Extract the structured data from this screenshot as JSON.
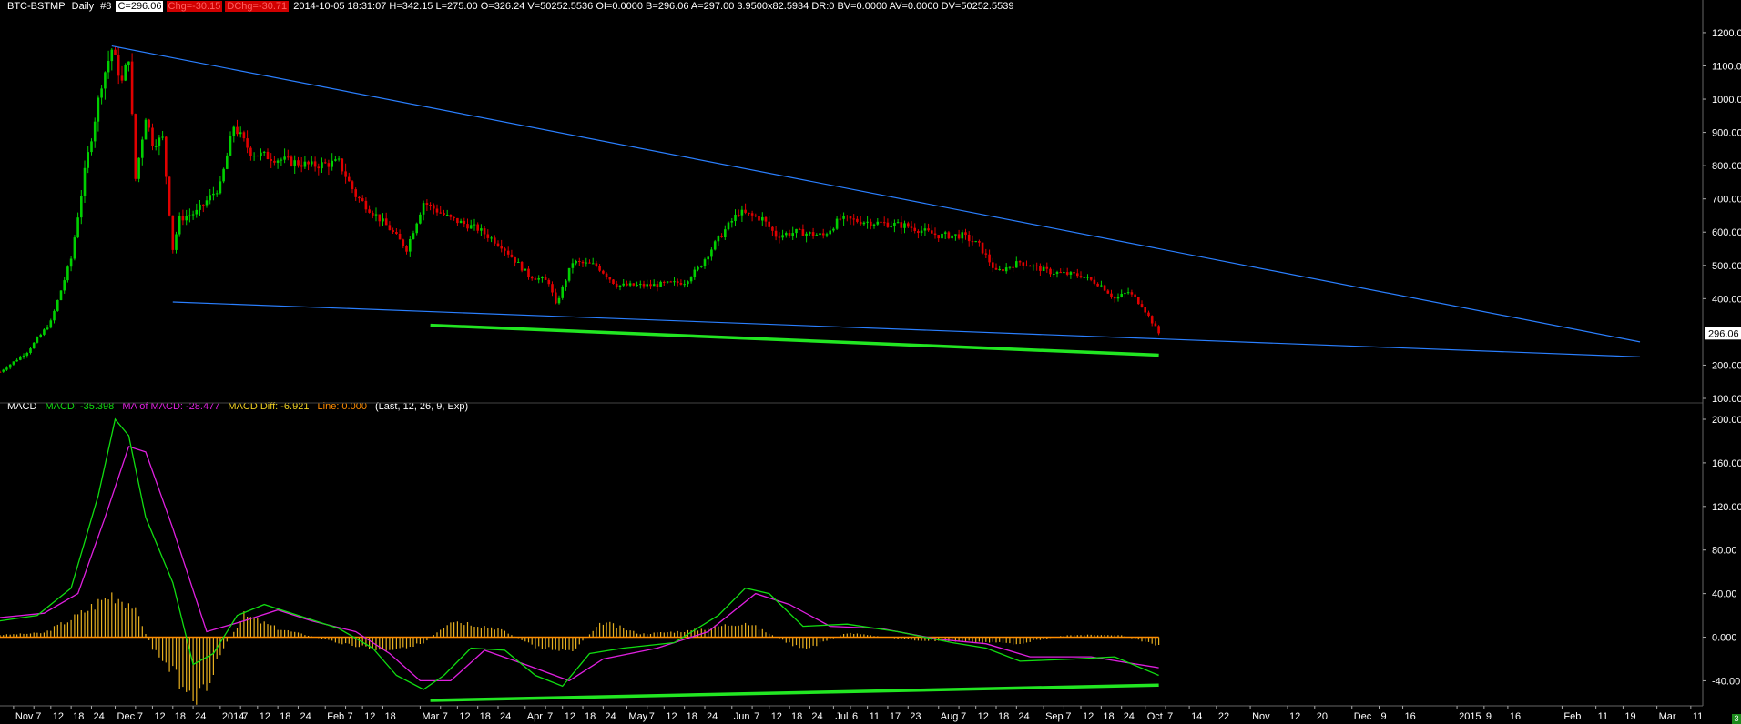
{
  "header": {
    "symbol": "BTC-BSTMP",
    "interval": "Daily",
    "chart_no": "#8",
    "close": "C=296.06",
    "chg": "Chg=-30.15",
    "dchg": "DChg=-30.71",
    "stats": "2014-10-05 18:31:07 H=342.15 L=275.00 O=326.24 V=50252.5536 OI=0.0000 B=296.06 A=297.00 3.9500x82.5934 DR:0 BV=0.0000 AV=0.0000 DV=50252.5539"
  },
  "macd_header": {
    "title": "MACD",
    "macd": "MACD: -35.398",
    "ma": "MA of MACD: -28.477",
    "diff": "MACD Diff: -6.921",
    "line": "Line: 0.000",
    "params": "(Last, 12, 26, 9, Exp)"
  },
  "colors": {
    "up": "#00d000",
    "down": "#e00000",
    "trend_blue": "#2a7fff",
    "support_green": "#22e622",
    "macd_green": "#11dd11",
    "ma_magenta": "#e020e0",
    "hist_gold": "#e8b020",
    "zero_line": "#ff8c00"
  },
  "corner_badge": "3",
  "chart_data": [
    {
      "type": "candlestick",
      "price_axis": {
        "range": [
          100,
          1260
        ],
        "ticks": [
          {
            "v": 1200,
            "t": "1200.00"
          },
          {
            "v": 1100,
            "t": "1100.00"
          },
          {
            "v": 1000,
            "t": "1000.00"
          },
          {
            "v": 900,
            "t": "900.00"
          },
          {
            "v": 800,
            "t": "800.00"
          },
          {
            "v": 700,
            "t": "700.00"
          },
          {
            "v": 600,
            "t": "600.00"
          },
          {
            "v": 500,
            "t": "500.00"
          },
          {
            "v": 400,
            "t": "400.00"
          },
          {
            "v": 200,
            "t": "200.00"
          },
          {
            "v": 100,
            "t": "100.00"
          }
        ]
      },
      "last_price": {
        "v": 296.06,
        "t": "296.06"
      },
      "date_axis": {
        "start": "2013-10-28",
        "end": "2015-03-14",
        "ticks": [
          {
            "d": "2013-11-01",
            "t": "Nov"
          },
          {
            "d": "2013-11-07",
            "t": "7"
          },
          {
            "d": "2013-11-12",
            "t": "12"
          },
          {
            "d": "2013-11-18",
            "t": "18"
          },
          {
            "d": "2013-11-24",
            "t": "24"
          },
          {
            "d": "2013-12-01",
            "t": "Dec"
          },
          {
            "d": "2013-12-07",
            "t": "7"
          },
          {
            "d": "2013-12-12",
            "t": "12"
          },
          {
            "d": "2013-12-18",
            "t": "18"
          },
          {
            "d": "2013-12-24",
            "t": "24"
          },
          {
            "d": "2014-01-01",
            "t": "2014"
          },
          {
            "d": "2014-01-07",
            "t": "7"
          },
          {
            "d": "2014-01-12",
            "t": "12"
          },
          {
            "d": "2014-01-18",
            "t": "18"
          },
          {
            "d": "2014-01-24",
            "t": "24"
          },
          {
            "d": "2014-02-01",
            "t": "Feb"
          },
          {
            "d": "2014-02-07",
            "t": "7"
          },
          {
            "d": "2014-02-12",
            "t": "12"
          },
          {
            "d": "2014-02-18",
            "t": "18"
          },
          {
            "d": "2014-03-01",
            "t": "Mar"
          },
          {
            "d": "2014-03-07",
            "t": "7"
          },
          {
            "d": "2014-03-12",
            "t": "12"
          },
          {
            "d": "2014-03-18",
            "t": "18"
          },
          {
            "d": "2014-03-24",
            "t": "24"
          },
          {
            "d": "2014-04-01",
            "t": "Apr"
          },
          {
            "d": "2014-04-07",
            "t": "7"
          },
          {
            "d": "2014-04-12",
            "t": "12"
          },
          {
            "d": "2014-04-18",
            "t": "18"
          },
          {
            "d": "2014-04-24",
            "t": "24"
          },
          {
            "d": "2014-05-01",
            "t": "May"
          },
          {
            "d": "2014-05-07",
            "t": "7"
          },
          {
            "d": "2014-05-12",
            "t": "12"
          },
          {
            "d": "2014-05-18",
            "t": "18"
          },
          {
            "d": "2014-05-24",
            "t": "24"
          },
          {
            "d": "2014-06-01",
            "t": "Jun"
          },
          {
            "d": "2014-06-07",
            "t": "7"
          },
          {
            "d": "2014-06-12",
            "t": "12"
          },
          {
            "d": "2014-06-18",
            "t": "18"
          },
          {
            "d": "2014-06-24",
            "t": "24"
          },
          {
            "d": "2014-07-01",
            "t": "Jul"
          },
          {
            "d": "2014-07-06",
            "t": "6"
          },
          {
            "d": "2014-07-11",
            "t": "11"
          },
          {
            "d": "2014-07-17",
            "t": "17"
          },
          {
            "d": "2014-07-23",
            "t": "23"
          },
          {
            "d": "2014-08-01",
            "t": "Aug"
          },
          {
            "d": "2014-08-07",
            "t": "7"
          },
          {
            "d": "2014-08-12",
            "t": "12"
          },
          {
            "d": "2014-08-18",
            "t": "18"
          },
          {
            "d": "2014-08-24",
            "t": "24"
          },
          {
            "d": "2014-09-01",
            "t": "Sep"
          },
          {
            "d": "2014-09-07",
            "t": "7"
          },
          {
            "d": "2014-09-12",
            "t": "12"
          },
          {
            "d": "2014-09-18",
            "t": "18"
          },
          {
            "d": "2014-09-24",
            "t": "24"
          },
          {
            "d": "2014-10-01",
            "t": "Oct"
          },
          {
            "d": "2014-10-07",
            "t": "7"
          },
          {
            "d": "2014-10-14",
            "t": "14"
          },
          {
            "d": "2014-10-22",
            "t": "22"
          },
          {
            "d": "2014-11-01",
            "t": "Nov"
          },
          {
            "d": "2014-11-12",
            "t": "12"
          },
          {
            "d": "2014-11-20",
            "t": "20"
          },
          {
            "d": "2014-12-01",
            "t": "Dec"
          },
          {
            "d": "2014-12-09",
            "t": "9"
          },
          {
            "d": "2014-12-16",
            "t": "16"
          },
          {
            "d": "2015-01-01",
            "t": "2015"
          },
          {
            "d": "2015-01-09",
            "t": "9"
          },
          {
            "d": "2015-01-16",
            "t": "16"
          },
          {
            "d": "2015-02-01",
            "t": "Feb"
          },
          {
            "d": "2015-02-11",
            "t": "11"
          },
          {
            "d": "2015-02-19",
            "t": "19"
          },
          {
            "d": "2015-03-01",
            "t": "Mar"
          },
          {
            "d": "2015-03-11",
            "t": "11"
          }
        ]
      },
      "close_path": [
        [
          "2013-10-28",
          180
        ],
        [
          "2013-11-05",
          240
        ],
        [
          "2013-11-12",
          330
        ],
        [
          "2013-11-18",
          520
        ],
        [
          "2013-11-22",
          780
        ],
        [
          "2013-11-27",
          1050
        ],
        [
          "2013-11-30",
          1150
        ],
        [
          "2013-12-03",
          1050
        ],
        [
          "2013-12-05",
          1130
        ],
        [
          "2013-12-07",
          760
        ],
        [
          "2013-12-10",
          950
        ],
        [
          "2013-12-12",
          870
        ],
        [
          "2013-12-15",
          880
        ],
        [
          "2013-12-18",
          550
        ],
        [
          "2013-12-20",
          640
        ],
        [
          "2013-12-25",
          660
        ],
        [
          "2014-01-01",
          740
        ],
        [
          "2014-01-05",
          920
        ],
        [
          "2014-01-10",
          840
        ],
        [
          "2014-01-18",
          820
        ],
        [
          "2014-01-28",
          800
        ],
        [
          "2014-02-05",
          810
        ],
        [
          "2014-02-10",
          710
        ],
        [
          "2014-02-15",
          660
        ],
        [
          "2014-02-20",
          610
        ],
        [
          "2014-02-25",
          550
        ],
        [
          "2014-03-02",
          690
        ],
        [
          "2014-03-10",
          640
        ],
        [
          "2014-03-18",
          610
        ],
        [
          "2014-03-25",
          560
        ],
        [
          "2014-04-02",
          470
        ],
        [
          "2014-04-08",
          450
        ],
        [
          "2014-04-10",
          380
        ],
        [
          "2014-04-15",
          510
        ],
        [
          "2014-04-22",
          500
        ],
        [
          "2014-04-28",
          440
        ],
        [
          "2014-05-08",
          440
        ],
        [
          "2014-05-18",
          450
        ],
        [
          "2014-05-22",
          490
        ],
        [
          "2014-05-28",
          580
        ],
        [
          "2014-06-03",
          660
        ],
        [
          "2014-06-10",
          640
        ],
        [
          "2014-06-14",
          590
        ],
        [
          "2014-06-20",
          600
        ],
        [
          "2014-06-28",
          590
        ],
        [
          "2014-07-03",
          640
        ],
        [
          "2014-07-12",
          630
        ],
        [
          "2014-07-22",
          620
        ],
        [
          "2014-08-01",
          590
        ],
        [
          "2014-08-08",
          590
        ],
        [
          "2014-08-13",
          560
        ],
        [
          "2014-08-18",
          480
        ],
        [
          "2014-08-25",
          510
        ],
        [
          "2014-09-03",
          480
        ],
        [
          "2014-09-12",
          470
        ],
        [
          "2014-09-18",
          440
        ],
        [
          "2014-09-22",
          400
        ],
        [
          "2014-09-26",
          420
        ],
        [
          "2014-09-30",
          380
        ],
        [
          "2014-10-03",
          330
        ],
        [
          "2014-10-05",
          296
        ]
      ],
      "trendlines": [
        {
          "name": "resistance",
          "from": [
            "2013-11-30",
            1160
          ],
          "to": [
            "2015-02-24",
            270
          ]
        },
        {
          "name": "wedge-support",
          "from": [
            "2013-12-18",
            390
          ],
          "to": [
            "2015-02-24",
            225
          ]
        }
      ],
      "support_line": {
        "from": [
          "2014-03-04",
          320
        ],
        "to": [
          "2014-10-05",
          230
        ]
      }
    },
    {
      "type": "macd",
      "value_axis": {
        "range": [
          -58,
          205
        ],
        "ticks": [
          {
            "v": 200,
            "t": "200.00"
          },
          {
            "v": 160,
            "t": "160.00"
          },
          {
            "v": 120,
            "t": "120.00"
          },
          {
            "v": 80,
            "t": "80.00"
          },
          {
            "v": 40,
            "t": "40.00"
          },
          {
            "v": 0,
            "t": "0.000"
          },
          {
            "v": -40,
            "t": "-40.00"
          }
        ]
      },
      "macd_path": [
        [
          "2013-10-28",
          15
        ],
        [
          "2013-11-08",
          20
        ],
        [
          "2013-11-18",
          45
        ],
        [
          "2013-11-26",
          130
        ],
        [
          "2013-12-01",
          200
        ],
        [
          "2013-12-05",
          185
        ],
        [
          "2013-12-10",
          110
        ],
        [
          "2013-12-18",
          50
        ],
        [
          "2013-12-24",
          -25
        ],
        [
          "2013-12-30",
          -15
        ],
        [
          "2014-01-06",
          20
        ],
        [
          "2014-01-14",
          30
        ],
        [
          "2014-01-24",
          20
        ],
        [
          "2014-02-05",
          8
        ],
        [
          "2014-02-15",
          -10
        ],
        [
          "2014-02-22",
          -35
        ],
        [
          "2014-03-02",
          -48
        ],
        [
          "2014-03-08",
          -35
        ],
        [
          "2014-03-16",
          -10
        ],
        [
          "2014-03-26",
          -12
        ],
        [
          "2014-04-04",
          -35
        ],
        [
          "2014-04-12",
          -45
        ],
        [
          "2014-04-20",
          -15
        ],
        [
          "2014-04-30",
          -10
        ],
        [
          "2014-05-15",
          -5
        ],
        [
          "2014-05-28",
          20
        ],
        [
          "2014-06-05",
          45
        ],
        [
          "2014-06-12",
          40
        ],
        [
          "2014-06-22",
          10
        ],
        [
          "2014-07-05",
          12
        ],
        [
          "2014-07-20",
          5
        ],
        [
          "2014-08-05",
          -5
        ],
        [
          "2014-08-15",
          -10
        ],
        [
          "2014-08-25",
          -22
        ],
        [
          "2014-09-10",
          -20
        ],
        [
          "2014-09-22",
          -18
        ],
        [
          "2014-10-05",
          -35
        ]
      ],
      "signal_path": [
        [
          "2013-10-28",
          18
        ],
        [
          "2013-11-10",
          22
        ],
        [
          "2013-11-20",
          40
        ],
        [
          "2013-11-28",
          110
        ],
        [
          "2013-12-05",
          175
        ],
        [
          "2013-12-10",
          170
        ],
        [
          "2013-12-18",
          100
        ],
        [
          "2013-12-28",
          5
        ],
        [
          "2014-01-08",
          15
        ],
        [
          "2014-01-18",
          25
        ],
        [
          "2014-01-28",
          15
        ],
        [
          "2014-02-10",
          5
        ],
        [
          "2014-02-20",
          -15
        ],
        [
          "2014-03-01",
          -40
        ],
        [
          "2014-03-10",
          -40
        ],
        [
          "2014-03-20",
          -12
        ],
        [
          "2014-04-01",
          -25
        ],
        [
          "2014-04-14",
          -40
        ],
        [
          "2014-04-24",
          -20
        ],
        [
          "2014-05-10",
          -10
        ],
        [
          "2014-05-25",
          5
        ],
        [
          "2014-06-08",
          40
        ],
        [
          "2014-06-18",
          30
        ],
        [
          "2014-06-30",
          10
        ],
        [
          "2014-07-15",
          8
        ],
        [
          "2014-08-01",
          -2
        ],
        [
          "2014-08-15",
          -6
        ],
        [
          "2014-08-28",
          -18
        ],
        [
          "2014-09-15",
          -18
        ],
        [
          "2014-10-05",
          -28
        ]
      ],
      "histogram_path": [
        [
          "2013-10-28",
          2
        ],
        [
          "2013-11-10",
          4
        ],
        [
          "2013-11-20",
          20
        ],
        [
          "2013-11-30",
          40
        ],
        [
          "2013-12-06",
          30
        ],
        [
          "2013-12-12",
          -10
        ],
        [
          "2013-12-20",
          -40
        ],
        [
          "2013-12-26",
          -55
        ],
        [
          "2014-01-02",
          -10
        ],
        [
          "2014-01-08",
          20
        ],
        [
          "2014-01-18",
          8
        ],
        [
          "2014-02-05",
          -5
        ],
        [
          "2014-02-18",
          -12
        ],
        [
          "2014-03-02",
          -6
        ],
        [
          "2014-03-10",
          16
        ],
        [
          "2014-03-24",
          8
        ],
        [
          "2014-04-05",
          -10
        ],
        [
          "2014-04-15",
          -12
        ],
        [
          "2014-04-24",
          14
        ],
        [
          "2014-05-05",
          3
        ],
        [
          "2014-05-20",
          6
        ],
        [
          "2014-06-05",
          14
        ],
        [
          "2014-06-22",
          -12
        ],
        [
          "2014-07-05",
          4
        ],
        [
          "2014-07-25",
          -3
        ],
        [
          "2014-08-10",
          -4
        ],
        [
          "2014-08-24",
          -6
        ],
        [
          "2014-09-08",
          2
        ],
        [
          "2014-09-24",
          2
        ],
        [
          "2014-10-05",
          -8
        ]
      ],
      "support_line": {
        "from": [
          "2014-03-04",
          -58
        ],
        "to": [
          "2014-10-05",
          -44
        ]
      }
    }
  ]
}
